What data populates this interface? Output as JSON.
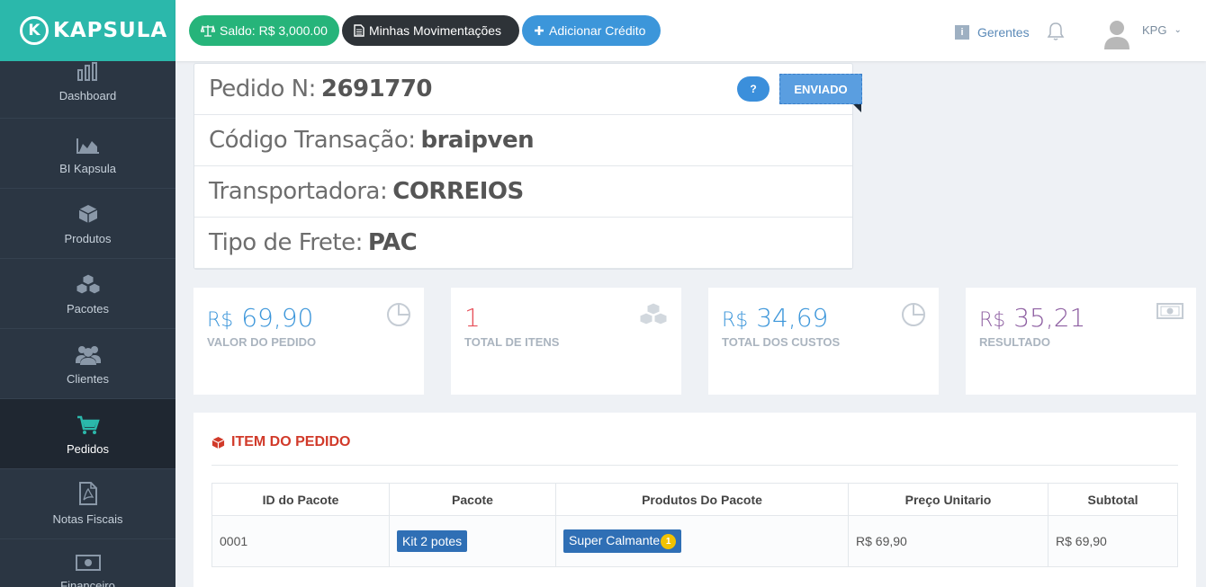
{
  "brand": {
    "logo_letter": "K",
    "name": "KAPSULA"
  },
  "sidebar": {
    "items": [
      {
        "label": "Dashboard",
        "icon": "bar-chart-icon"
      },
      {
        "label": "BI Kapsula",
        "icon": "area-chart-icon"
      },
      {
        "label": "Produtos",
        "icon": "cube-icon"
      },
      {
        "label": "Pacotes",
        "icon": "cubes-icon"
      },
      {
        "label": "Clientes",
        "icon": "users-icon"
      },
      {
        "label": "Pedidos",
        "icon": "shopping-cart-icon",
        "active": true
      },
      {
        "label": "Notas Fiscais",
        "icon": "pdf-file-icon"
      },
      {
        "label": "Financeiro",
        "icon": "money-icon"
      }
    ]
  },
  "topbar": {
    "saldo_label": "Saldo: R$ 3,000.00",
    "movimentacoes_label": "Minhas Movimentações",
    "adicionar_label": "Adicionar Crédito",
    "gerentes_label": "Gerentes",
    "user_name": "KPG"
  },
  "order": {
    "pedido_label": "Pedido N:",
    "pedido_value": "2691770",
    "codigo_label": "Código Transação:",
    "codigo_value": "braipven",
    "transportadora_label": "Transportadora:",
    "transportadora_value": "CORREIOS",
    "frete_label": "Tipo de Frete:",
    "frete_value": "PAC",
    "help_label": "?",
    "status": "ENVIADO"
  },
  "stats": [
    {
      "prefix": "R$",
      "value": "69,90",
      "label": "VALOR DO PEDIDO",
      "color": "#3c96da",
      "icon": "pie-chart-icon"
    },
    {
      "prefix": "",
      "value": "1",
      "label": "TOTAL DE ITENS",
      "color": "#e7505a",
      "icon": "cubes-icon"
    },
    {
      "prefix": "R$",
      "value": "34,69",
      "label": "TOTAL DOS CUSTOS",
      "color": "#3c96da",
      "icon": "pie-chart-icon"
    },
    {
      "prefix": "R$",
      "value": "35,21",
      "label": "RESULTADO",
      "color": "#8e5fa2",
      "icon": "money-icon"
    }
  ],
  "items": {
    "title": "ITEM DO PEDIDO",
    "columns": [
      "ID do Pacote",
      "Pacote",
      "Produtos Do Pacote",
      "Preço Unitario",
      "Subtotal"
    ],
    "rows": [
      {
        "id": "0001",
        "pacote": "Kit 2 potes",
        "produto": "Super Calmante",
        "produto_qty": "1",
        "preco": "R$ 69,90",
        "subtotal": "R$ 69,90"
      }
    ]
  },
  "colors": {
    "accent": "#2bb8ab",
    "sidebar": "#2b3643",
    "success": "#26b47a",
    "primary": "#3c96da",
    "danger": "#d13a2a"
  }
}
